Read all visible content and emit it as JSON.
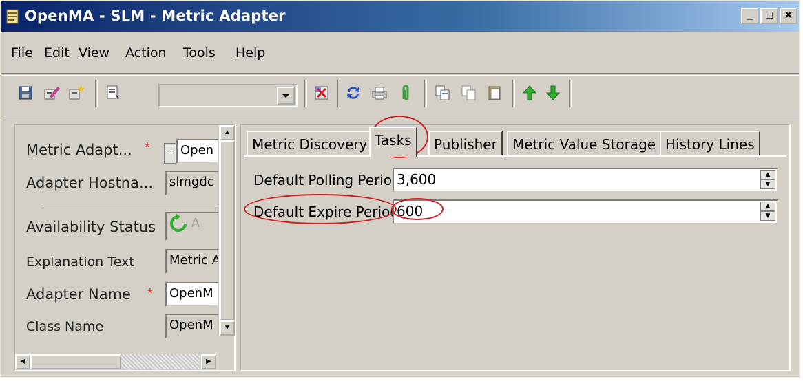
{
  "window": {
    "title": "OpenMA - SLM - Metric Adapter",
    "controls": {
      "minimize": "_",
      "maximize": "□",
      "close": "✕"
    }
  },
  "menu": [
    {
      "label": "File",
      "u": "F",
      "rest": "ile"
    },
    {
      "label": "Edit",
      "u": "E",
      "rest": "dit"
    },
    {
      "label": "View",
      "u": "V",
      "rest": "iew"
    },
    {
      "label": "Action",
      "u": "A",
      "rest": "ction"
    },
    {
      "label": "Tools",
      "u": "T",
      "rest": "ools"
    },
    {
      "label": "Help",
      "u": "H",
      "rest": "elp"
    }
  ],
  "toolbar": {
    "combo_value": "",
    "icons": [
      "save-icon",
      "edit-icon",
      "new-icon",
      "properties-icon",
      "delete-icon",
      "refresh-icon",
      "print-icon",
      "attach-icon",
      "copy-icon",
      "paste-icon",
      "clipboard-icon",
      "arrow-up-icon",
      "arrow-down-icon"
    ]
  },
  "left_panel": {
    "fields": [
      {
        "label": "Metric Adapt...",
        "value": "Open",
        "required": true
      },
      {
        "label": "Adapter Hostna...",
        "value": "slmgdc",
        "required": false
      },
      {
        "label": "Availability Status",
        "value": "A",
        "required": false
      },
      {
        "label": "Explanation Text",
        "value": "Metric A",
        "required": false
      },
      {
        "label": "Adapter Name",
        "value": "OpenM",
        "required": true
      },
      {
        "label": "Class Name",
        "value": "OpenM",
        "required": false
      }
    ]
  },
  "tabs": [
    "Metric Discovery",
    "Tasks",
    "Publisher",
    "Metric Value Storage",
    "History Lines"
  ],
  "active_tab": "Tasks",
  "tasks": {
    "fields": [
      {
        "label": "Default Polling Period",
        "value": "3,600"
      },
      {
        "label": "Default Expire Period",
        "value": "600"
      }
    ]
  },
  "colors": {
    "title_start": "#0a246a",
    "title_end": "#a6caf0",
    "face": "#d4d0c8",
    "highlight": "#d02020",
    "required": "#e04040"
  }
}
